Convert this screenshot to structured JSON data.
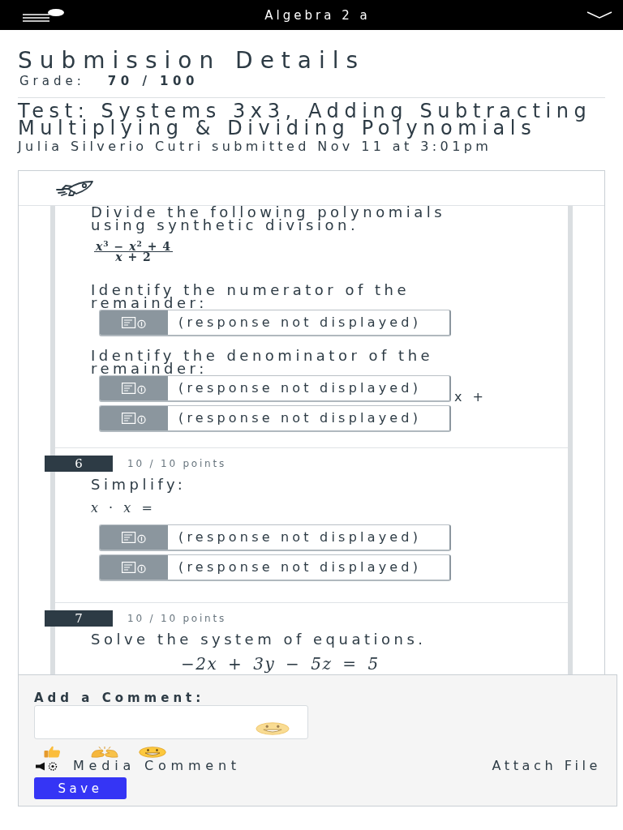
{
  "top_bar": {
    "title": "Algebra 2 a"
  },
  "header": {
    "title": "Submission Details",
    "grade_label": "Grade:",
    "grade_value": "70 / 100"
  },
  "assignment": {
    "title": "Test: Systems 3x3, Adding Subtracting Multiplying & Dividing Polynomials",
    "submitted": "Julia Silverio Cutri submitted Nov 11 at 3:01pm"
  },
  "questions": [
    {
      "blocks": [
        {
          "kind": "text",
          "text": "Divide the following polynomials using synthetic division."
        },
        {
          "kind": "fraction",
          "numerator": "*x*$^{3}$ − *x*$^{2}$ + 4",
          "denominator": "*x* + 2"
        },
        {
          "kind": "text",
          "text": "Identify the numerator of the remainder:"
        },
        {
          "kind": "responses",
          "items": [
            {
              "text": "(response not displayed)"
            }
          ]
        },
        {
          "kind": "text",
          "text": "Identify the denominator of the remainder:"
        },
        {
          "kind": "responses",
          "items": [
            {
              "text": "(response not displayed)",
              "suffix": "x +"
            },
            {
              "text": "(response not displayed)"
            }
          ]
        }
      ]
    },
    {
      "number": "6",
      "points": "10 / 10 points",
      "blocks": [
        {
          "kind": "text",
          "text": "Simplify:"
        },
        {
          "kind": "math",
          "text": "*x* · *x* ="
        },
        {
          "kind": "responses",
          "items": [
            {
              "text": "(response not displayed)"
            },
            {
              "text": "(response not displayed)"
            }
          ]
        }
      ]
    },
    {
      "number": "7",
      "points": "10 / 10 points",
      "blocks": [
        {
          "kind": "text",
          "text": "Solve the system of equations."
        },
        {
          "kind": "equation",
          "text": "−2x + 3y − 5z = 5"
        }
      ]
    }
  ],
  "comment": {
    "label": "Add a Comment:",
    "media_comment": "Media Comment",
    "attach_file": "Attach File",
    "save": "Save"
  }
}
